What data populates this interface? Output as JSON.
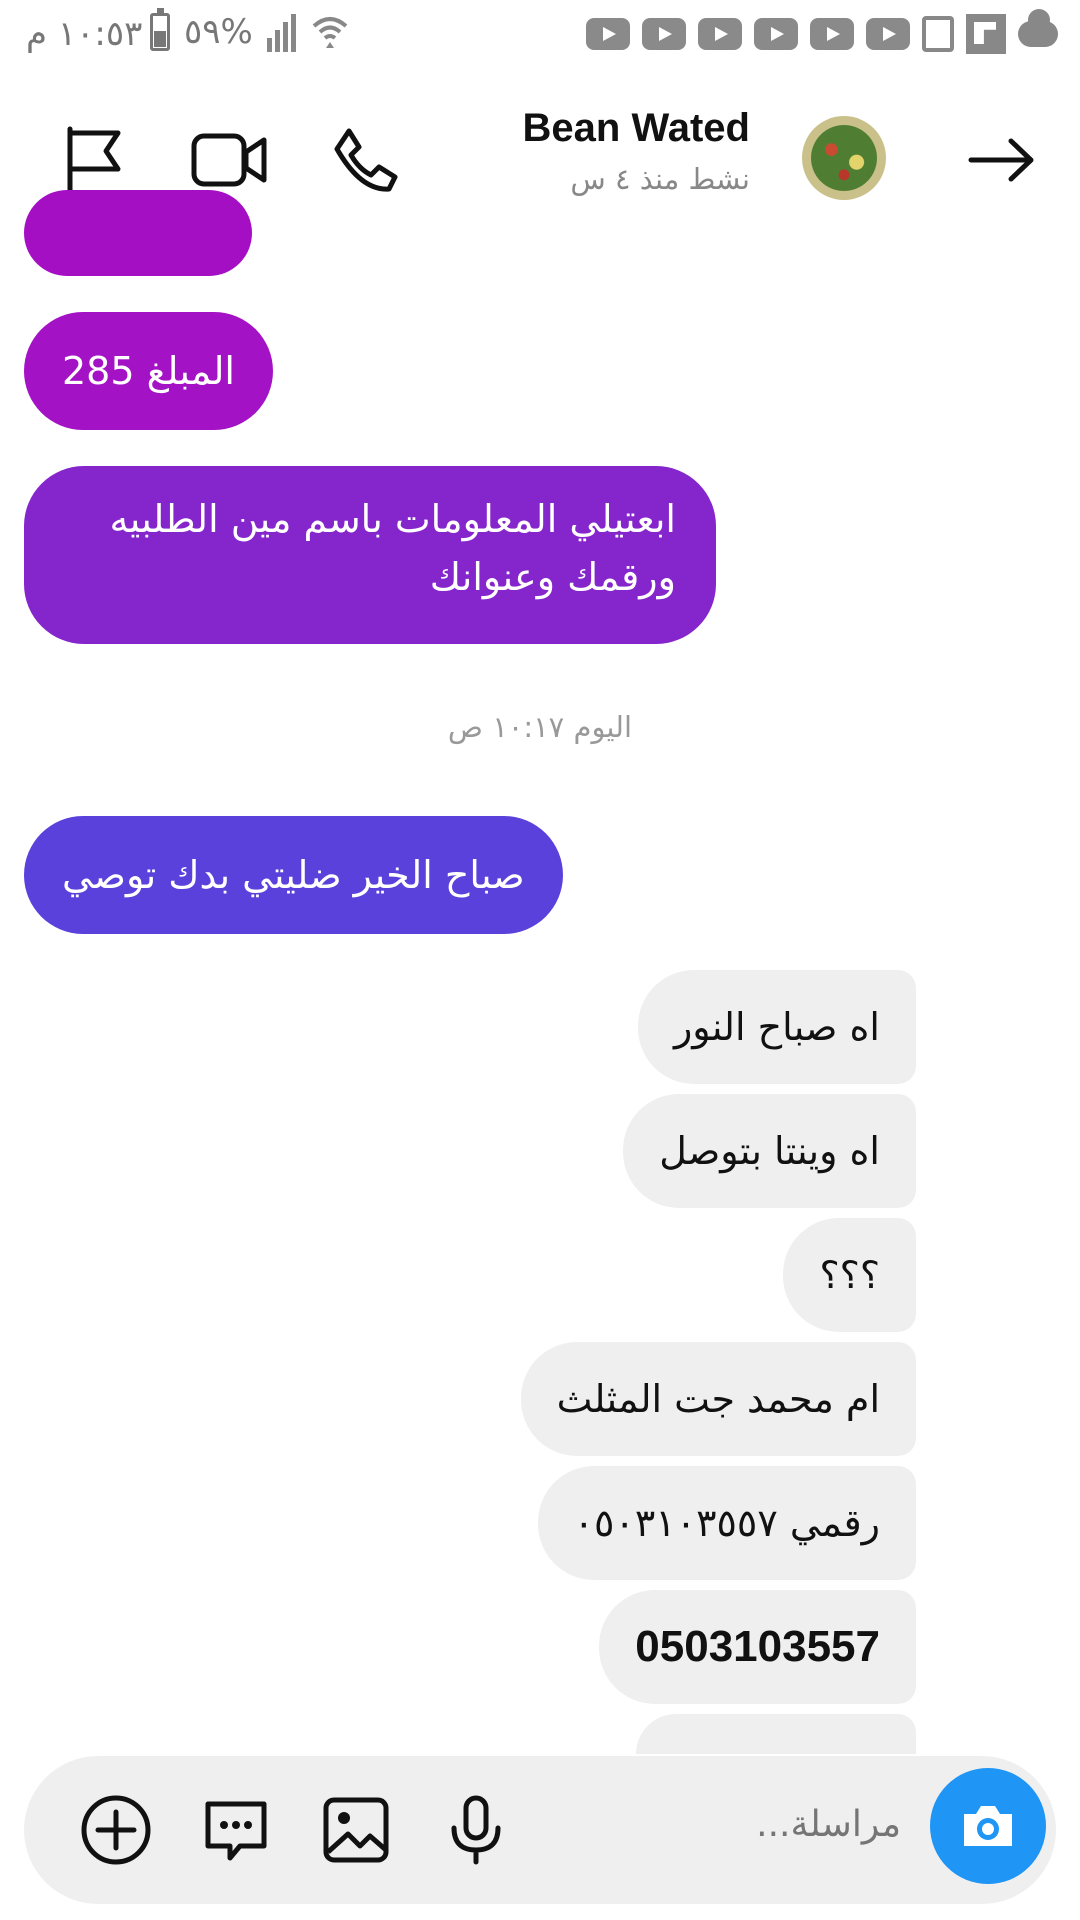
{
  "status_bar": {
    "time": "١٠:٥٣ م",
    "battery": "%٥٩",
    "icons": [
      "wifi-icon",
      "signal-icon",
      "battery-icon",
      "youtube-icon",
      "image-icon",
      "flipboard-icon",
      "cloud-icon"
    ]
  },
  "header": {
    "contact_name": "Bean Wated",
    "contact_status": "نشط منذ ٤ س",
    "icons": [
      "flag-icon",
      "video-call-icon",
      "phone-icon",
      "forward-arrow-icon"
    ]
  },
  "messages": [
    {
      "id": "m1",
      "side": "sent",
      "text": "المبلغ 285"
    },
    {
      "id": "m2",
      "side": "sent",
      "text": "ابعتيلي المعلومات باسم مين الطلبيه",
      "text2": "ورقمك وعنوانك"
    },
    {
      "id": "m3",
      "side": "sent",
      "text": "صباح الخير ضليتي بدك توصي"
    },
    {
      "id": "r1",
      "side": "received",
      "text": "اه صباح النور"
    },
    {
      "id": "r2",
      "side": "received",
      "text": "اه وينتا بتوصل"
    },
    {
      "id": "r3",
      "side": "received",
      "text": "؟؟؟"
    },
    {
      "id": "r4",
      "side": "received",
      "text": "ام محمد جت المثلث"
    },
    {
      "id": "r5",
      "side": "received",
      "text": "رقمي ٠٥٠٣١٠٣٥٥٧"
    },
    {
      "id": "r6",
      "side": "received",
      "text": "0503103557"
    }
  ],
  "timestamp": "اليوم ١٠:١٧ ص",
  "composer": {
    "placeholder": "مراسلة...",
    "icons": [
      "add-icon",
      "sticker-icon",
      "gallery-icon",
      "microphone-icon",
      "camera-icon"
    ]
  },
  "colors": {
    "gradient_top": "#a50fc4",
    "gradient_mid": "#7b2bd1",
    "gradient_bottom": "#5b41db",
    "received_bg": "#efefef",
    "camera_blue": "#1f95f5"
  }
}
